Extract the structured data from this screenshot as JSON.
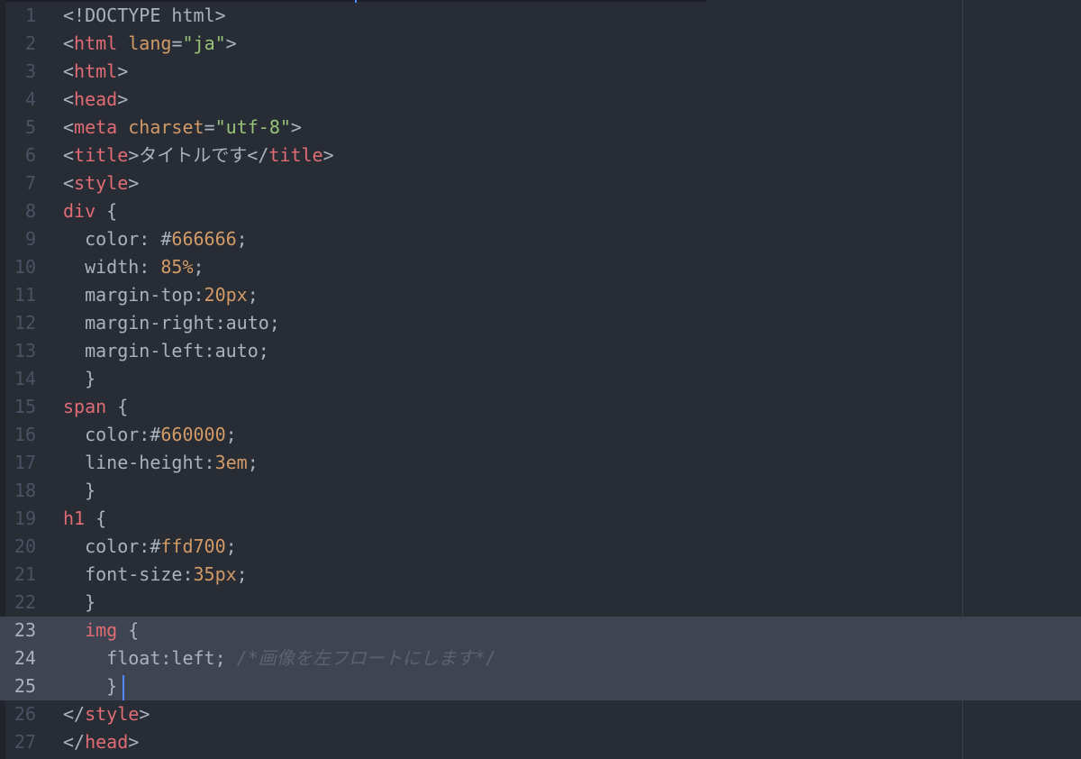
{
  "editor": {
    "theme_colors": {
      "background": "#282c34",
      "selection": "#3e4451",
      "tag": "#e06c75",
      "attribute": "#d19a66",
      "string": "#98c379",
      "number": "#d19a66",
      "text": "#abb2bf",
      "comment": "#5c6370",
      "cursor": "#528bff"
    },
    "lines": [
      {
        "n": "1",
        "t": [
          {
            "c": "txt",
            "v": "<!DOCTYPE html>"
          }
        ]
      },
      {
        "n": "2",
        "t": [
          {
            "c": "txt",
            "v": "<"
          },
          {
            "c": "tag",
            "v": "html"
          },
          {
            "c": "txt",
            "v": " "
          },
          {
            "c": "attr",
            "v": "lang"
          },
          {
            "c": "txt",
            "v": "="
          },
          {
            "c": "str",
            "v": "\"ja\""
          },
          {
            "c": "txt",
            "v": ">"
          }
        ]
      },
      {
        "n": "3",
        "t": [
          {
            "c": "txt",
            "v": "<"
          },
          {
            "c": "tag",
            "v": "html"
          },
          {
            "c": "txt",
            "v": ">"
          }
        ]
      },
      {
        "n": "4",
        "t": [
          {
            "c": "txt",
            "v": "<"
          },
          {
            "c": "tag",
            "v": "head"
          },
          {
            "c": "txt",
            "v": ">"
          }
        ]
      },
      {
        "n": "5",
        "t": [
          {
            "c": "txt",
            "v": "<"
          },
          {
            "c": "tag",
            "v": "meta"
          },
          {
            "c": "txt",
            "v": " "
          },
          {
            "c": "attr",
            "v": "charset"
          },
          {
            "c": "txt",
            "v": "="
          },
          {
            "c": "str",
            "v": "\"utf-8\""
          },
          {
            "c": "txt",
            "v": ">"
          }
        ]
      },
      {
        "n": "6",
        "t": [
          {
            "c": "txt",
            "v": "<"
          },
          {
            "c": "tag",
            "v": "title"
          },
          {
            "c": "txt",
            "v": ">タイトルです</"
          },
          {
            "c": "tag",
            "v": "title"
          },
          {
            "c": "txt",
            "v": ">"
          }
        ]
      },
      {
        "n": "7",
        "t": [
          {
            "c": "txt",
            "v": "<"
          },
          {
            "c": "tag",
            "v": "style"
          },
          {
            "c": "txt",
            "v": ">"
          }
        ]
      },
      {
        "n": "8",
        "t": [
          {
            "c": "tag",
            "v": "div"
          },
          {
            "c": "txt",
            "v": " {"
          }
        ]
      },
      {
        "n": "9",
        "t": [
          {
            "c": "txt",
            "v": "  color: "
          },
          {
            "c": "txt",
            "v": "#"
          },
          {
            "c": "num",
            "v": "666666"
          },
          {
            "c": "txt",
            "v": ";"
          }
        ]
      },
      {
        "n": "10",
        "t": [
          {
            "c": "txt",
            "v": "  width: "
          },
          {
            "c": "num",
            "v": "85%"
          },
          {
            "c": "txt",
            "v": ";"
          }
        ]
      },
      {
        "n": "11",
        "t": [
          {
            "c": "txt",
            "v": "  margin-top:"
          },
          {
            "c": "num",
            "v": "20px"
          },
          {
            "c": "txt",
            "v": ";"
          }
        ]
      },
      {
        "n": "12",
        "t": [
          {
            "c": "txt",
            "v": "  margin-right:auto;"
          }
        ]
      },
      {
        "n": "13",
        "t": [
          {
            "c": "txt",
            "v": "  margin-left:auto;"
          }
        ]
      },
      {
        "n": "14",
        "t": [
          {
            "c": "txt",
            "v": "  }"
          }
        ]
      },
      {
        "n": "15",
        "t": [
          {
            "c": "tag",
            "v": "span"
          },
          {
            "c": "txt",
            "v": " {"
          }
        ]
      },
      {
        "n": "16",
        "t": [
          {
            "c": "txt",
            "v": "  color:"
          },
          {
            "c": "txt",
            "v": "#"
          },
          {
            "c": "num",
            "v": "660000"
          },
          {
            "c": "txt",
            "v": ";"
          }
        ]
      },
      {
        "n": "17",
        "t": [
          {
            "c": "txt",
            "v": "  line-height:"
          },
          {
            "c": "num",
            "v": "3em"
          },
          {
            "c": "txt",
            "v": ";"
          }
        ]
      },
      {
        "n": "18",
        "t": [
          {
            "c": "txt",
            "v": "  }"
          }
        ]
      },
      {
        "n": "19",
        "t": [
          {
            "c": "tag",
            "v": "h1"
          },
          {
            "c": "txt",
            "v": " {"
          }
        ]
      },
      {
        "n": "20",
        "t": [
          {
            "c": "txt",
            "v": "  color:"
          },
          {
            "c": "txt",
            "v": "#"
          },
          {
            "c": "num",
            "v": "ffd700"
          },
          {
            "c": "txt",
            "v": ";"
          }
        ]
      },
      {
        "n": "21",
        "t": [
          {
            "c": "txt",
            "v": "  font-size:"
          },
          {
            "c": "num",
            "v": "35px"
          },
          {
            "c": "txt",
            "v": ";"
          }
        ]
      },
      {
        "n": "22",
        "t": [
          {
            "c": "txt",
            "v": "  }"
          }
        ]
      },
      {
        "n": "23",
        "sel": true,
        "t": [
          {
            "c": "txt",
            "v": "  "
          },
          {
            "c": "tag",
            "v": "img"
          },
          {
            "c": "txt",
            "v": " {"
          }
        ]
      },
      {
        "n": "24",
        "sel": true,
        "t": [
          {
            "c": "txt",
            "v": "    float:left; "
          },
          {
            "c": "cmt",
            "v": "/*画像を左フロートにします*/"
          }
        ]
      },
      {
        "n": "25",
        "sel": true,
        "cursor": true,
        "t": [
          {
            "c": "txt",
            "v": "    }"
          }
        ]
      },
      {
        "n": "26",
        "t": [
          {
            "c": "txt",
            "v": "</"
          },
          {
            "c": "tag",
            "v": "style"
          },
          {
            "c": "txt",
            "v": ">"
          }
        ]
      },
      {
        "n": "27",
        "t": [
          {
            "c": "txt",
            "v": "</"
          },
          {
            "c": "tag",
            "v": "head"
          },
          {
            "c": "txt",
            "v": ">"
          }
        ]
      }
    ]
  }
}
